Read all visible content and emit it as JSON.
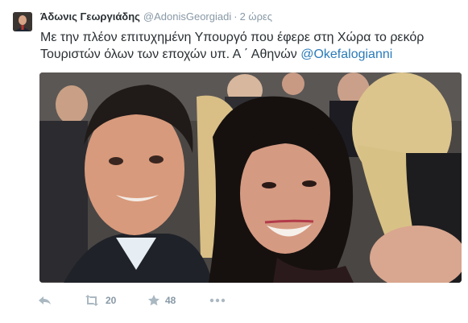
{
  "tweet": {
    "author_name": "Άδωνις Γεωργιάδης",
    "author_handle": "@AdonisGeorgiadi",
    "separator": "·",
    "timestamp": "2 ώρες",
    "text": "Με την πλέον επιτυχημένη Υπουργό που έφερε στη Χώρα το ρεκόρ Τουριστών όλων των εποχών υπ. Α ΄ Αθηνών ",
    "mention": "@Okefalogianni"
  },
  "actions": {
    "reply_icon": "reply-icon",
    "retweet_icon": "retweet-icon",
    "retweet_count": "20",
    "favorite_icon": "star-icon",
    "favorite_count": "48",
    "more_icon": "more-icon"
  },
  "colors": {
    "link": "#2b7bb9",
    "muted": "#8899a6",
    "text": "#292f33"
  }
}
